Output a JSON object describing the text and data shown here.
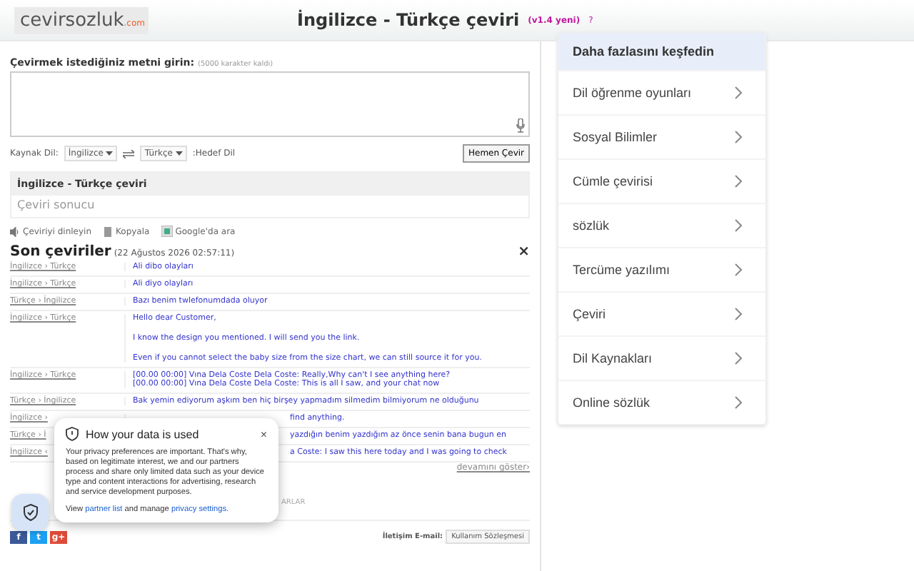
{
  "header": {
    "logo": "cevirsozluk",
    "logo_suffix": ".com",
    "title": "İngilizce - Türkçe çeviri",
    "version": "(v1.4 yeni)",
    "help": "?"
  },
  "input": {
    "label": "Çevirmek istediğiniz metni girin:",
    "hint": "(5000 karakter kaldı)"
  },
  "controls": {
    "source_label": "Kaynak Dil:",
    "source": "İngilizce",
    "target": "Türkçe",
    "target_label": ":Hedef Dil",
    "button": "Hemen Çevir"
  },
  "result": {
    "title": "İngilizce - Türkçe çeviri",
    "placeholder": "Çeviri sonucu"
  },
  "actions": [
    "Çeviriyi dinleyin",
    "Kopyala",
    "Google'da ara"
  ],
  "history": {
    "title": "Son çeviriler",
    "date": "(22 Ağustos 2026 02:57:11)",
    "close": "×",
    "more": "devamını göster›",
    "rows": [
      {
        "lang": "İngilizce › Türkçe",
        "covered": false,
        "lines": [
          "Ali dibo olayları"
        ]
      },
      {
        "lang": "İngilizce › Türkçe",
        "covered": false,
        "lines": [
          "Ali diyo olayları"
        ]
      },
      {
        "lang": "Türkçe › İngilizce",
        "covered": false,
        "lines": [
          "Bazı benim twlefonumdada oluyor"
        ]
      },
      {
        "lang": "İngilizce › Türkçe",
        "covered": false,
        "lines": [
          "Hello dear Customer,",
          "I know the design you mentioned. I will send you the link.",
          "Even if you cannot select the baby size from the size chart, we can still source it for you."
        ]
      },
      {
        "lang": "İngilizce › Türkçe",
        "covered": false,
        "lines": [
          "[00.00 00:00] Vına Dela Coste Dela Coste: Really,Why can't I see anything here?\n[00.00 00:00] Vına Dela Coste Dela Coste: This is all I saw, and your chat now"
        ]
      },
      {
        "lang": "Türkçe › İngilizce",
        "covered": false,
        "lines": [
          "Bak yemin ediyorum aşkım ben hiç birşey yapmadım silmedim bilmiyorum ne olduğunu"
        ]
      },
      {
        "lang": "İngilizce ›",
        "covered": true,
        "lines": [
          "find anything."
        ]
      },
      {
        "lang": "Türkçe › İ",
        "covered": true,
        "lines": [
          "yazdığın benim yazdığım az önce senin bana bugun en"
        ]
      },
      {
        "lang": "İngilizce ‹",
        "covered": true,
        "lines": [
          "a Coste: I saw this here today and I was going to check"
        ]
      }
    ]
  },
  "footer_note": "ARLAR",
  "footer": {
    "social": [
      "f",
      "t",
      "g+"
    ],
    "contact": "İletişim E-mail:",
    "terms": "Kullanım Sözleşmesi"
  },
  "explore": {
    "title": "Daha fazlasını keşfedin",
    "items": [
      "Dil öğrenme oyunları",
      "Sosyal Bilimler",
      "Cümle çevirisi",
      "sözlük",
      "Tercüme yazılımı",
      "Çeviri",
      "Dil Kaynakları",
      "Online sözlük"
    ]
  },
  "privacy": {
    "title": "How your data is used",
    "close": "×",
    "body": "Your privacy preferences are important. That's why, based on legitimate interest, we and our partners process and share only limited data such as your device type and content interactions for advertising, research and service development purposes.",
    "view": "View",
    "partner_link": "partner list",
    "mid": "and manage",
    "settings_link": "privacy settings."
  }
}
